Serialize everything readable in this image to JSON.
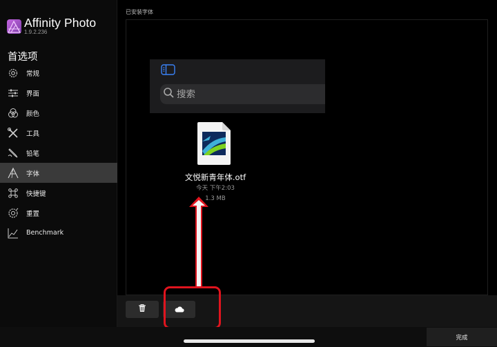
{
  "app": {
    "name": "Affinity Photo",
    "version": "1.9.2.236"
  },
  "sidebar": {
    "title": "首选项",
    "items": [
      {
        "label": "常规",
        "icon": "gear-icon"
      },
      {
        "label": "界面",
        "icon": "sliders-icon"
      },
      {
        "label": "颜色",
        "icon": "color-circles-icon"
      },
      {
        "label": "工具",
        "icon": "tools-icon"
      },
      {
        "label": "铅笔",
        "icon": "pencil-icon"
      },
      {
        "label": "字体",
        "icon": "font-icon",
        "active": true
      },
      {
        "label": "快捷键",
        "icon": "command-key-icon"
      },
      {
        "label": "重置",
        "icon": "reset-gear-icon"
      },
      {
        "label": "Benchmark",
        "icon": "chart-icon"
      }
    ]
  },
  "panel": {
    "header": "已安装字体"
  },
  "picker": {
    "search_placeholder": "搜索"
  },
  "file": {
    "name": "文悦新青年体.otf",
    "date": "今天 下午2:03",
    "size": "1.3 MB"
  },
  "toolbar": {
    "trash_icon": "trash-icon",
    "cloud_icon": "cloud-icon"
  },
  "footer": {
    "done_label": "完成"
  },
  "colors": {
    "annotation_red": "#e0141e",
    "active_item_bg": "#3a3a3a",
    "accent_blue": "#3a82f7"
  }
}
